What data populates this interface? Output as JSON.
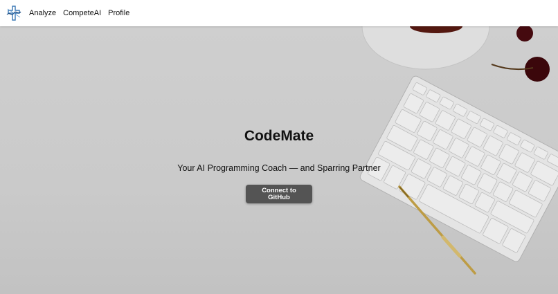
{
  "nav": {
    "logo_icon": "medical-cross-logo",
    "links": [
      "Analyze",
      "CompeteAI",
      "Profile"
    ]
  },
  "hero": {
    "title": "CodeMate",
    "tagline": "Your AI Programming Coach — and Sparring Partner",
    "cta_label": "Connect to GitHub",
    "background_image": "desk-with-keyboard-coffee-cherries-pen"
  },
  "colors": {
    "button_bg": "#545454",
    "button_text": "#ffffff",
    "logo_blue": "#3a78b5"
  }
}
